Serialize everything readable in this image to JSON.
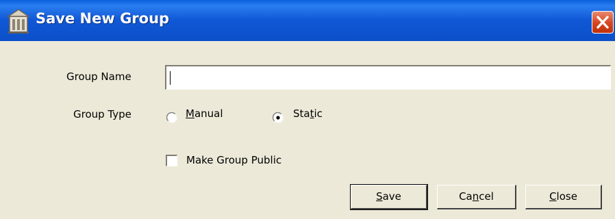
{
  "window": {
    "title": "Save New Group",
    "icon": "group-building-icon",
    "close_icon": "close-x-icon"
  },
  "form": {
    "group_name_label": "Group Name",
    "group_name_value": "",
    "group_type_label": "Group Type",
    "group_type_options": [
      {
        "label_pre": "",
        "label_accel": "M",
        "label_post": "anual",
        "selected": false
      },
      {
        "label_pre": "Sta",
        "label_accel": "t",
        "label_post": "ic",
        "selected": true
      }
    ],
    "make_public_label": "Make Group Public",
    "make_public_checked": false
  },
  "buttons": {
    "save": {
      "accel": "S",
      "rest": "ave"
    },
    "cancel": {
      "pre": "Ca",
      "accel": "n",
      "post": "cel"
    },
    "close": {
      "accel": "C",
      "rest": "lose"
    }
  },
  "colors": {
    "titlebar": "#0b4fc9",
    "dialog_bg": "#ece9d8",
    "close_button": "#d5451f"
  }
}
